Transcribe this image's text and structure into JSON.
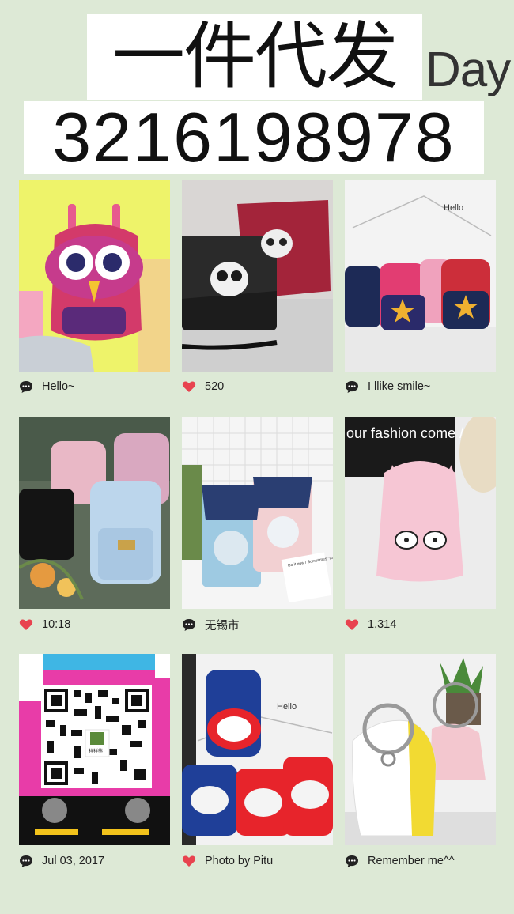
{
  "header": {
    "title": "一件代发",
    "day": "Day",
    "number": "3216198978"
  },
  "photos": [
    {
      "caption": "Hello~",
      "icon": "speech-bubble-icon",
      "overlay_text": ""
    },
    {
      "caption": "520",
      "icon": "heart-icon",
      "overlay_text": ""
    },
    {
      "caption": "I llike smile~",
      "icon": "speech-bubble-icon",
      "overlay_text": "Hello"
    },
    {
      "caption": "10:18",
      "icon": "heart-icon",
      "overlay_text": ""
    },
    {
      "caption": "无锡市",
      "icon": "speech-bubble-icon",
      "overlay_text": "Do it now / Sometimes \"Later\" becomes \"Never\""
    },
    {
      "caption": "1,314",
      "icon": "heart-icon",
      "overlay_text": "our fashion come / oure the st"
    },
    {
      "caption": "Jul 03, 2017",
      "icon": "speech-bubble-icon",
      "overlay_text": "祥祥熊"
    },
    {
      "caption": "Photo by Pitu",
      "icon": "heart-icon",
      "overlay_text": "Hello"
    },
    {
      "caption": "Remember me^^",
      "icon": "speech-bubble-icon",
      "overlay_text": ""
    }
  ],
  "colors": {
    "background": "#dde9d6",
    "heart": "#e8434f",
    "speech_bubble": "#222222"
  }
}
